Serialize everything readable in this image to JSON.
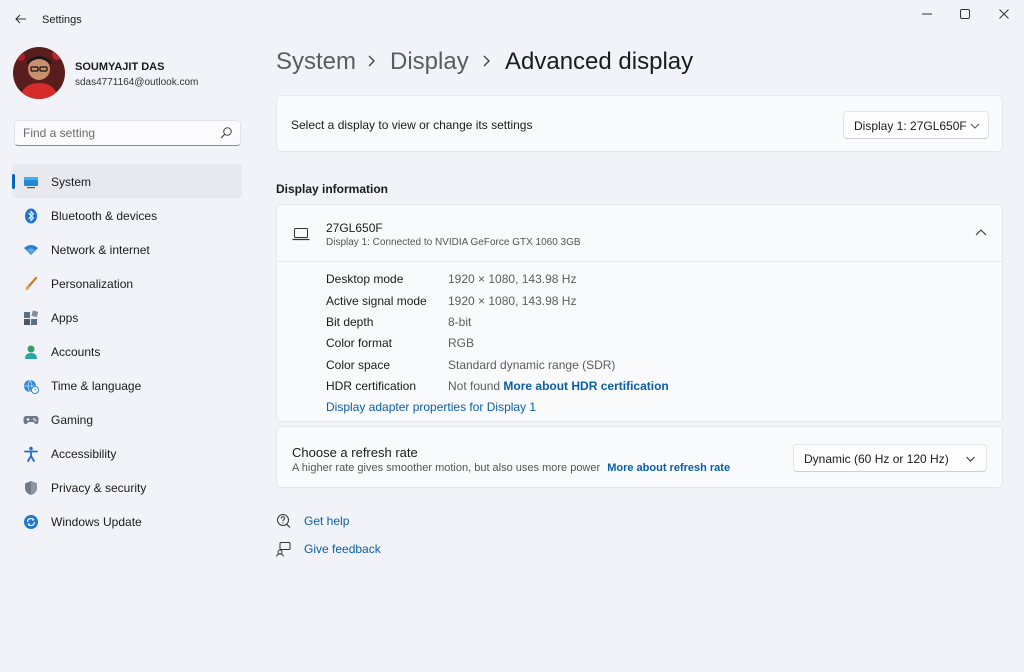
{
  "window": {
    "title": "Settings"
  },
  "user": {
    "name": "SOUMYAJIT DAS",
    "email": "sdas4771164@outlook.com"
  },
  "search": {
    "placeholder": "Find a setting"
  },
  "nav": [
    {
      "label": "System",
      "icon": "monitor-icon",
      "active": true
    },
    {
      "label": "Bluetooth & devices",
      "icon": "bluetooth-icon"
    },
    {
      "label": "Network & internet",
      "icon": "wifi-icon"
    },
    {
      "label": "Personalization",
      "icon": "brush-icon"
    },
    {
      "label": "Apps",
      "icon": "apps-icon"
    },
    {
      "label": "Accounts",
      "icon": "person-icon"
    },
    {
      "label": "Time & language",
      "icon": "globe-clock-icon"
    },
    {
      "label": "Gaming",
      "icon": "gamepad-icon"
    },
    {
      "label": "Accessibility",
      "icon": "accessibility-icon"
    },
    {
      "label": "Privacy & security",
      "icon": "shield-icon"
    },
    {
      "label": "Windows Update",
      "icon": "update-icon"
    }
  ],
  "breadcrumb": {
    "level1": "System",
    "level2": "Display",
    "current": "Advanced display"
  },
  "display_select": {
    "label": "Select a display to view or change its settings",
    "value": "Display 1: 27GL650F"
  },
  "display_info": {
    "section_title": "Display information",
    "name": "27GL650F",
    "subtitle": "Display 1: Connected to NVIDIA GeForce GTX 1060 3GB",
    "rows": [
      {
        "key": "Desktop mode",
        "value": "1920 × 1080, 143.98 Hz"
      },
      {
        "key": "Active signal mode",
        "value": "1920 × 1080, 143.98 Hz"
      },
      {
        "key": "Bit depth",
        "value": "8-bit"
      },
      {
        "key": "Color format",
        "value": "RGB"
      },
      {
        "key": "Color space",
        "value": "Standard dynamic range (SDR)"
      },
      {
        "key": "HDR certification",
        "value": "Not found",
        "link": "More about HDR certification"
      }
    ],
    "adapter_link": "Display adapter properties for Display 1"
  },
  "refresh": {
    "title": "Choose a refresh rate",
    "subtitle": "A higher rate gives smoother motion, but also uses more power",
    "link": "More about refresh rate",
    "value": "Dynamic (60 Hz or 120 Hz)"
  },
  "help": {
    "get_help": "Get help",
    "feedback": "Give feedback"
  },
  "colors": {
    "accent": "#0067c0",
    "link": "#0a5ea8",
    "background": "#f1f3f9",
    "card": "#f9fafc"
  }
}
